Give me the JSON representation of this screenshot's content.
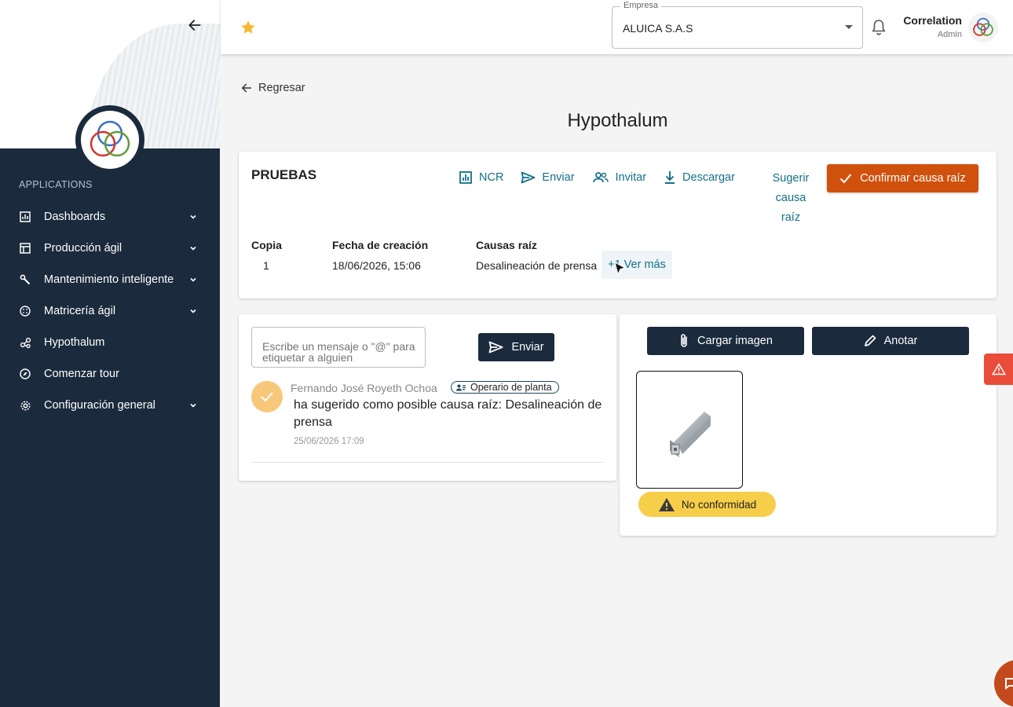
{
  "sidebar": {
    "section_label": "APPLICATIONS",
    "items": [
      {
        "label": "Dashboards",
        "icon": "chart-icon",
        "has_submenu": true
      },
      {
        "label": "Producción ágil",
        "icon": "table-icon",
        "has_submenu": true
      },
      {
        "label": "Mantenimiento inteligente",
        "icon": "wrench-icon",
        "has_submenu": true
      },
      {
        "label": "Matricería ágil",
        "icon": "grid-circle-icon",
        "has_submenu": true
      },
      {
        "label": "Hypothalum",
        "icon": "hypothalum-icon",
        "has_submenu": false
      },
      {
        "label": "Comenzar tour",
        "icon": "compass-icon",
        "has_submenu": false
      },
      {
        "label": "Configuración general",
        "icon": "gear-icon",
        "has_submenu": true
      }
    ]
  },
  "topbar": {
    "company_legend": "Empresa",
    "company_value": "ALUICA S.A.S",
    "user_name": "Correlation",
    "user_role": "Admin"
  },
  "page": {
    "back_label": "Regresar",
    "title": "Hypothalum"
  },
  "case": {
    "name": "PRUEBAS",
    "actions": {
      "ncr": "NCR",
      "send": "Enviar",
      "invite": "Invitar",
      "download": "Descargar",
      "suggest_line1": "Sugerir",
      "suggest_line2": "causa",
      "suggest_line3": "raíz",
      "confirm": "Confirmar causa raíz"
    },
    "fields": {
      "copy_label": "Copia",
      "copy_value": "1",
      "created_label": "Fecha de creación",
      "created_value": "18/06/2026, 15:06",
      "root_label": "Causas raíz",
      "root_value": "Desalineación de prensa",
      "see_more": "+1 Ver más"
    }
  },
  "chat": {
    "placeholder": "Escribe un mensaje o \"@\" para etiquetar a alguien",
    "send_label": "Enviar",
    "messages": [
      {
        "author": "Fernando José Royeth Ochoa",
        "role": "Operario de planta",
        "text": "ha sugerido como posible causa raíz: Desalineación de prensa",
        "time": "25/06/2026 17:09"
      }
    ]
  },
  "images": {
    "upload_label": "Cargar imagen",
    "annotate_label": "Anotar",
    "badge": "No conformidad"
  },
  "colors": {
    "sidebar_bg": "#1b2a3d",
    "accent_link": "#13708a",
    "confirm": "#d0510d",
    "badge_yellow": "#f7ce4a",
    "alert_red": "#ea4c3a"
  }
}
